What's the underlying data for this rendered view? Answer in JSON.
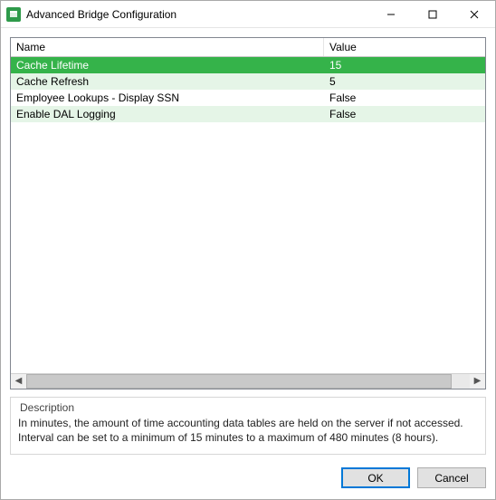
{
  "window": {
    "title": "Advanced Bridge Configuration"
  },
  "grid": {
    "columns": {
      "name": "Name",
      "value": "Value"
    },
    "rows": [
      {
        "name": "Cache Lifetime",
        "value": "15",
        "state": "selected"
      },
      {
        "name": "Cache Refresh",
        "value": "5",
        "state": "alt"
      },
      {
        "name": "Employee Lookups - Display SSN",
        "value": "False",
        "state": "normal"
      },
      {
        "name": "Enable DAL Logging",
        "value": "False",
        "state": "alt"
      }
    ]
  },
  "description": {
    "label": "Description",
    "text": "In minutes, the amount of time accounting data tables are held on the server if not accessed. Interval can be set to a minimum of 15 minutes to a maximum of 480 minutes (8 hours)."
  },
  "buttons": {
    "ok": "OK",
    "cancel": "Cancel"
  }
}
